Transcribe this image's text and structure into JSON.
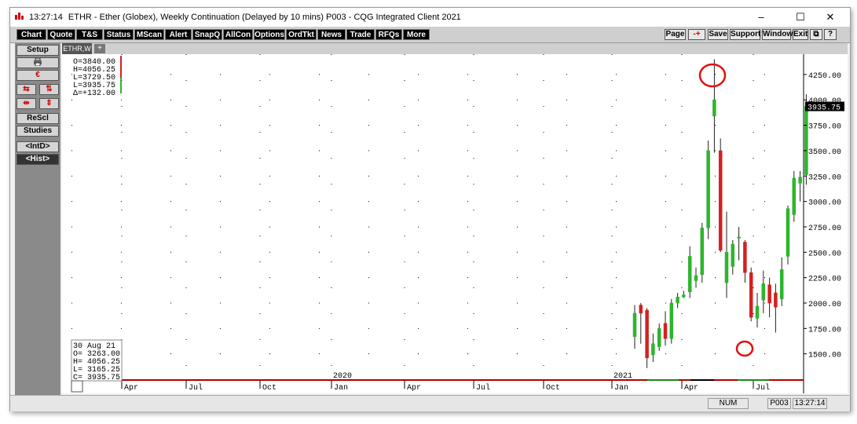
{
  "window": {
    "time": "13:27:14",
    "title": "ETHR - Ether (Globex), Weekly Continuation (Delayed by 10 mins)  P003 - CQG Integrated Client 2021",
    "controls": [
      "–",
      "☐",
      "✕"
    ]
  },
  "toolbar": {
    "left": [
      "Chart",
      "Quote",
      "T&S",
      "Status",
      "MScan",
      "Alert",
      "SnapQ",
      "AllCon",
      "Options",
      "OrdTkt",
      "News",
      "Trade",
      "RFQs",
      "More"
    ],
    "right": [
      "Page",
      "-+",
      "Save",
      "Support",
      "Window",
      "Exit",
      "⧉",
      "?"
    ]
  },
  "sidebar": {
    "setup": "Setup",
    "print_icon": "printer-icon",
    "rescale": "ReScl",
    "studies": "Studies",
    "intd": "<IntD>",
    "hist": "<Hist>"
  },
  "chart_tab": {
    "label": "ETHR,W",
    "add": "+"
  },
  "ohlc_header": [
    "O=3840.00",
    "H=4056.25",
    "L=3729.50",
    "L=3935.75",
    "Δ=+132.00"
  ],
  "cursor_box": [
    "30  Aug 21",
    "O=  3263.00",
    "H=  4056.25",
    "L=  3165.25",
    "C=  3935.75"
  ],
  "last_price": "3935.75",
  "colors": {
    "up": "#2db52d",
    "down": "#d42020",
    "annotation": "#e01010",
    "grid": "#000000"
  },
  "status": {
    "num": "NUM",
    "page": "P003",
    "time": "13:27:14"
  },
  "chart_data": {
    "type": "candlestick",
    "symbol": "ETHR,W",
    "ylim": [
      1250,
      4450
    ],
    "y_ticks": [
      1500,
      1750,
      2000,
      2250,
      2500,
      2750,
      3000,
      3250,
      3500,
      3750,
      4000,
      4250
    ],
    "y_tick_labels": [
      "1500.00",
      "1750.00",
      "2000.00",
      "2250.00",
      "2500.00",
      "2750.00",
      "3000.00",
      "3250.00",
      "3500.00",
      "3750.00",
      "4000.00",
      "4250.00"
    ],
    "x_labels": [
      "Apr",
      "Jul",
      "Oct",
      "Jan",
      "Apr",
      "Jul",
      "Oct",
      "Jan",
      "Apr",
      "Jul"
    ],
    "year_labels": [
      "2020",
      "2021"
    ],
    "candles": [
      {
        "o": 1670,
        "h": 1980,
        "l": 1550,
        "c": 1900
      },
      {
        "o": 1980,
        "h": 2000,
        "l": 1600,
        "c": 1900
      },
      {
        "o": 1930,
        "h": 1950,
        "l": 1360,
        "c": 1460
      },
      {
        "o": 1490,
        "h": 1700,
        "l": 1420,
        "c": 1600
      },
      {
        "o": 1570,
        "h": 1800,
        "l": 1530,
        "c": 1750
      },
      {
        "o": 1800,
        "h": 1920,
        "l": 1580,
        "c": 1650
      },
      {
        "o": 1650,
        "h": 2040,
        "l": 1600,
        "c": 2000
      },
      {
        "o": 2000,
        "h": 2100,
        "l": 1950,
        "c": 2060
      },
      {
        "o": 2060,
        "h": 2120,
        "l": 2050,
        "c": 2080
      },
      {
        "o": 2110,
        "h": 2560,
        "l": 2050,
        "c": 2460
      },
      {
        "o": 2220,
        "h": 2350,
        "l": 2150,
        "c": 2270
      },
      {
        "o": 2280,
        "h": 2790,
        "l": 2200,
        "c": 2740
      },
      {
        "o": 2740,
        "h": 3600,
        "l": 2630,
        "c": 3500
      },
      {
        "o": 3840,
        "h": 4400,
        "l": 3480,
        "c": 4000
      },
      {
        "o": 3500,
        "h": 3620,
        "l": 2500,
        "c": 2520
      },
      {
        "o": 2200,
        "h": 2900,
        "l": 2050,
        "c": 2500
      },
      {
        "o": 2360,
        "h": 2620,
        "l": 2280,
        "c": 2580
      },
      {
        "o": 2640,
        "h": 2750,
        "l": 2420,
        "c": 2650
      },
      {
        "o": 2600,
        "h": 2620,
        "l": 2200,
        "c": 2300
      },
      {
        "o": 2300,
        "h": 2350,
        "l": 1820,
        "c": 1860
      },
      {
        "o": 1850,
        "h": 2100,
        "l": 1760,
        "c": 1970
      },
      {
        "o": 2030,
        "h": 2320,
        "l": 1900,
        "c": 2190
      },
      {
        "o": 2180,
        "h": 2250,
        "l": 1860,
        "c": 2000
      },
      {
        "o": 2100,
        "h": 2190,
        "l": 1710,
        "c": 1960
      },
      {
        "o": 2040,
        "h": 2450,
        "l": 1970,
        "c": 2330
      },
      {
        "o": 2460,
        "h": 2960,
        "l": 2380,
        "c": 2930
      },
      {
        "o": 2870,
        "h": 3300,
        "l": 2800,
        "c": 3230
      },
      {
        "o": 3180,
        "h": 3300,
        "l": 3000,
        "c": 3240
      },
      {
        "o": 3263,
        "h": 4056.25,
        "l": 3165.25,
        "c": 3935.75
      }
    ]
  }
}
